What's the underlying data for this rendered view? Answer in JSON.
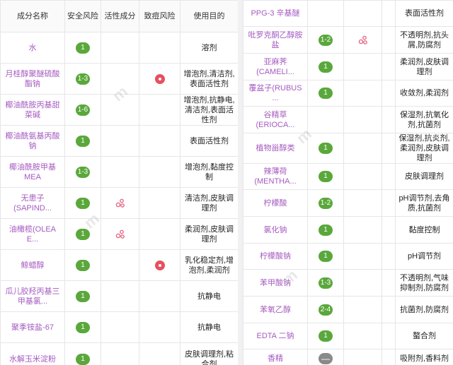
{
  "left_table": {
    "headers": [
      "成分名称",
      "安全风险",
      "活性成分",
      "致痘风险",
      "使用目的"
    ],
    "rows": [
      {
        "name": "水",
        "safety": "1",
        "active": false,
        "acne": false,
        "purpose": "溶剂"
      },
      {
        "name": "月桂醇聚醚硫酸酯钠",
        "safety": "1-3",
        "active": false,
        "acne": true,
        "purpose": "增泡剂,清洁剂,表面活性剂"
      },
      {
        "name": "椰油酰胺丙基甜菜碱",
        "safety": "1-6",
        "active": false,
        "acne": false,
        "purpose": "增泡剂,抗静电,清洁剂,表面活性剂"
      },
      {
        "name": "椰油酰氨基丙酸钠",
        "safety": "1",
        "active": false,
        "acne": false,
        "purpose": "表面活性剂"
      },
      {
        "name": "椰油酰胺甲基MEA",
        "safety": "1-3",
        "active": false,
        "acne": false,
        "purpose": "增泡剂,黏度控制"
      },
      {
        "name": "无患子(SAPIND...",
        "safety": "1",
        "active": true,
        "acne": false,
        "purpose": "清洁剂,皮肤调理剂"
      },
      {
        "name": "油橄榄(OLEA E...",
        "safety": "1",
        "active": true,
        "acne": false,
        "purpose": "柔润剂,皮肤调理剂"
      },
      {
        "name": "鲸蜡醇",
        "safety": "1",
        "active": false,
        "acne": true,
        "purpose": "乳化稳定剂,增泡剂,柔润剂"
      },
      {
        "name": "瓜儿胶羟丙基三甲基氯...",
        "safety": "1",
        "active": false,
        "acne": false,
        "purpose": "抗静电"
      },
      {
        "name": "聚季铵盐-67",
        "safety": "1",
        "active": false,
        "acne": false,
        "purpose": "抗静电"
      },
      {
        "name": "水解玉米淀粉",
        "safety": "1",
        "active": false,
        "acne": false,
        "purpose": "皮肤调理剂,粘合剂"
      }
    ]
  },
  "right_table": {
    "rows": [
      {
        "name": "PPG-3 辛基醚",
        "safety": "",
        "active": false,
        "purpose": "表面活性剂"
      },
      {
        "name": "吡罗克酮乙醇胺盐",
        "safety": "1-2",
        "active": true,
        "purpose": "不透明剂,抗头屑,防腐剂"
      },
      {
        "name": "亚麻荠(CAMELI...",
        "safety": "1",
        "active": false,
        "purpose": "柔润剂,皮肤调理剂"
      },
      {
        "name": "覆盆子(RUBUS ...",
        "safety": "1",
        "active": false,
        "purpose": "收敛剂,柔润剂"
      },
      {
        "name": "谷精草(ERIOCA...",
        "safety": "",
        "active": false,
        "purpose": "保湿剂,抗氧化剂,抗菌剂"
      },
      {
        "name": "植物甾醇类",
        "safety": "1",
        "active": false,
        "purpose": "保湿剂,抗炎剂,柔润剂,皮肤调理剂"
      },
      {
        "name": "辣薄荷(MENTHA...",
        "safety": "1",
        "active": false,
        "purpose": "皮肤调理剂"
      },
      {
        "name": "柠檬酸",
        "safety": "1-2",
        "active": false,
        "purpose": "pH调节剂,去角质,抗菌剂"
      },
      {
        "name": "氯化钠",
        "safety": "1",
        "active": false,
        "purpose": "黏度控制"
      },
      {
        "name": "柠檬酸钠",
        "safety": "1",
        "active": false,
        "purpose": "pH调节剂"
      },
      {
        "name": "苯甲酸钠",
        "safety": "1-3",
        "active": false,
        "purpose": "不透明剂,气味抑制剂,防腐剂"
      },
      {
        "name": "苯氧乙醇",
        "safety": "2-4",
        "active": false,
        "purpose": "抗菌剂,防腐剂"
      },
      {
        "name": "EDTA 二钠",
        "safety": "1",
        "active": false,
        "purpose": "螯合剂"
      },
      {
        "name": "香精",
        "safety": "—",
        "active": false,
        "purpose": "吸附剂,香料剂"
      }
    ]
  },
  "colors": {
    "name_purple": "#a55bc0",
    "badge_green": "#5aa83c",
    "acne_red": "#e6505f",
    "active_pink": "#e66a86"
  },
  "icons": {
    "active": "molecule-icon",
    "acne": "acne-risk-icon"
  }
}
